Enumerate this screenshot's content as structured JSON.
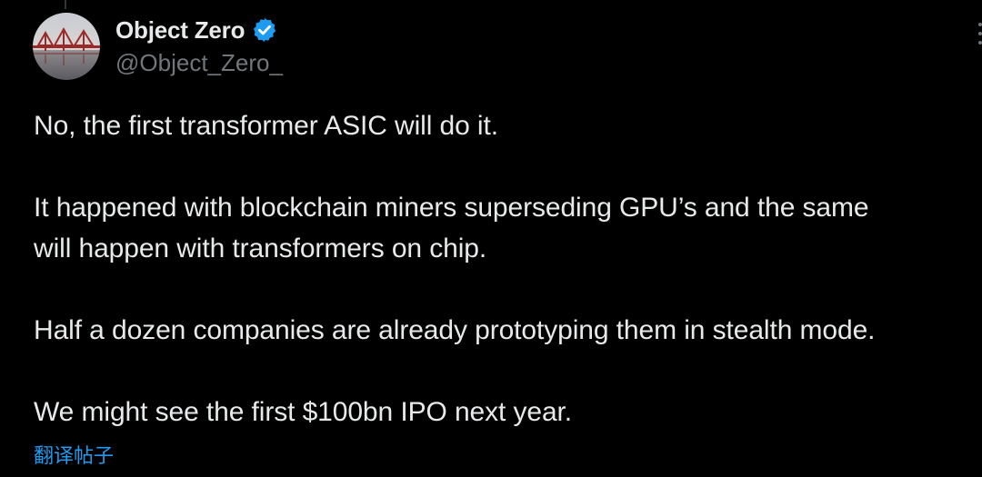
{
  "author": {
    "display_name": "Object Zero",
    "handle": "@Object_Zero_",
    "verified": true,
    "avatar_icon": "bridge-avatar"
  },
  "tweet": {
    "paragraphs": [
      {
        "lines": [
          "No, the first transformer ASIC will do it."
        ]
      },
      {
        "lines": [
          "It happened with blockchain miners superseding GPU’s and the same",
          "will happen with transformers on chip."
        ]
      },
      {
        "lines": [
          "Half a dozen companies are already prototyping them in stealth mode."
        ]
      },
      {
        "lines": [
          "We might see the first $100bn IPO next year."
        ]
      }
    ]
  },
  "translate_label": "翻译帖子",
  "colors": {
    "background": "#000000",
    "text": "#e7e9ea",
    "secondary_text": "#71767b",
    "accent": "#1d9bf0"
  }
}
